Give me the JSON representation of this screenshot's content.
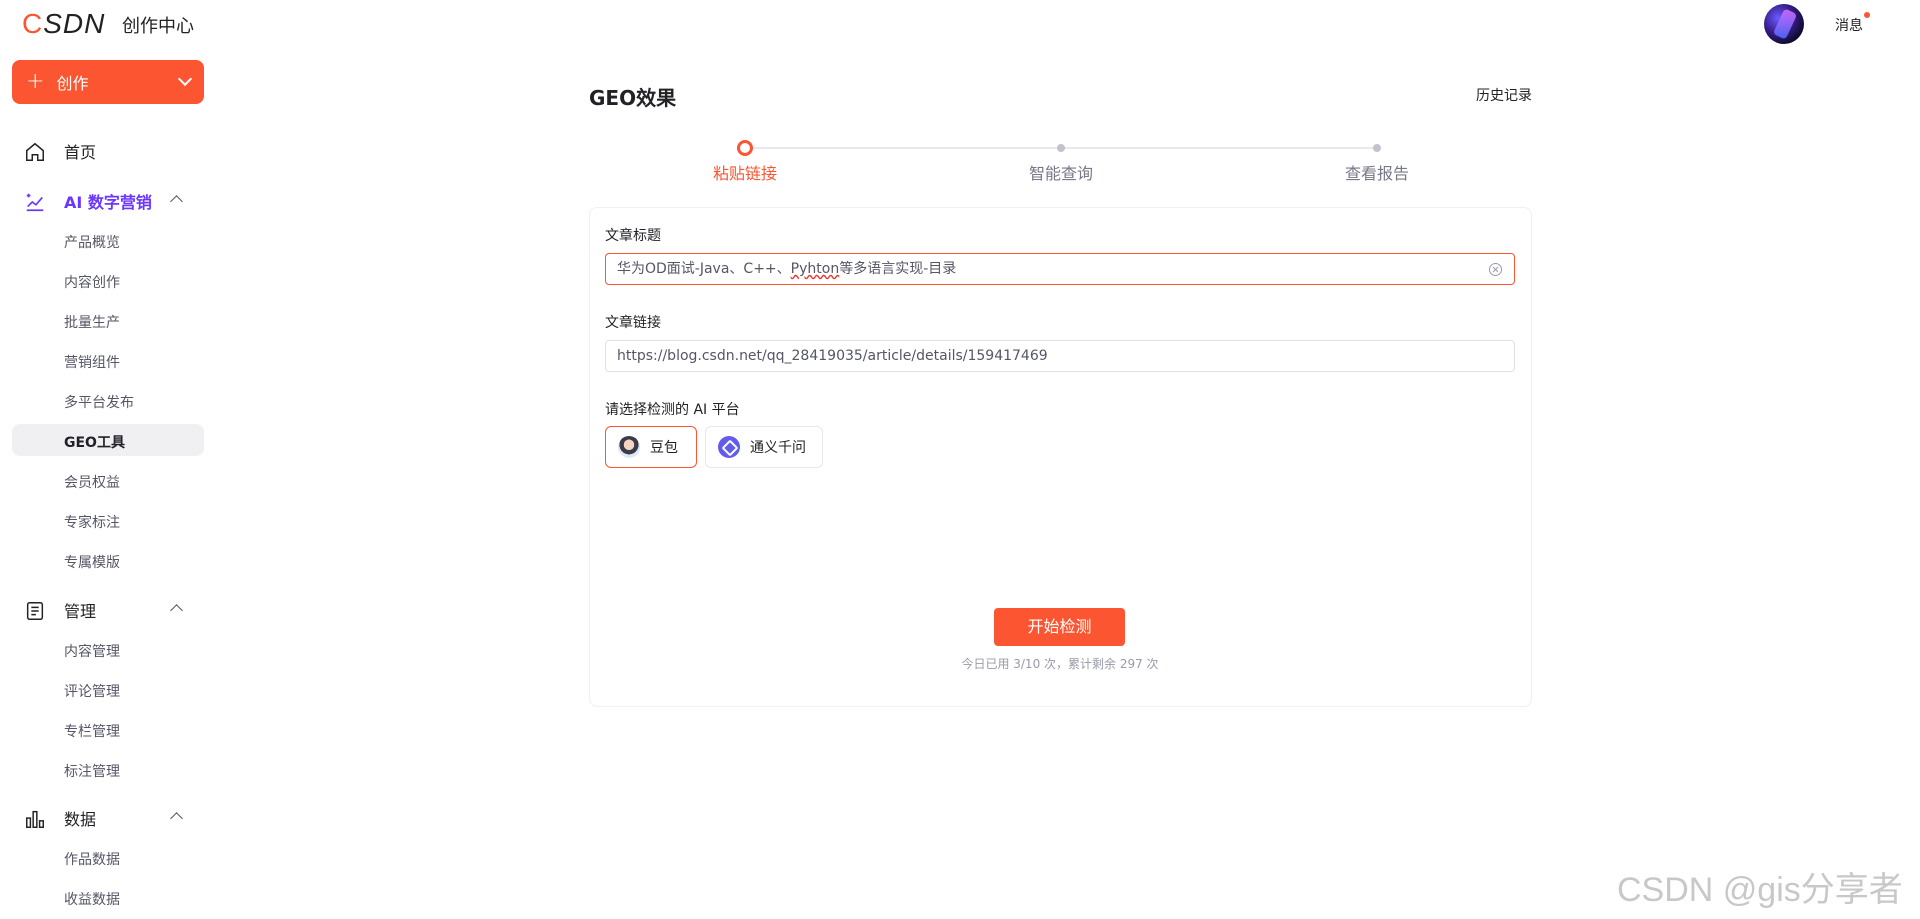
{
  "header": {
    "logo": "CSDN",
    "app_title": "创作中心",
    "messages_label": "消息"
  },
  "sidebar": {
    "create_button": "创作",
    "home": "首页",
    "sections": [
      {
        "title": "AI 数字营销",
        "items": [
          "产品概览",
          "内容创作",
          "批量生产",
          "营销组件",
          "多平台发布",
          "GEO工具",
          "会员权益",
          "专家标注",
          "专属模版"
        ]
      },
      {
        "title": "管理",
        "items": [
          "内容管理",
          "评论管理",
          "专栏管理",
          "标注管理"
        ]
      },
      {
        "title": "数据",
        "items": [
          "作品数据",
          "收益数据"
        ]
      }
    ],
    "active_item": "GEO工具"
  },
  "main": {
    "title": "GEO效果",
    "history_link": "历史记录",
    "steps": [
      "粘贴链接",
      "智能查询",
      "查看报告"
    ],
    "current_step": 1,
    "form": {
      "title_label": "文章标题",
      "title_value_a": "华为OD面试-Java、C++、",
      "title_value_misspelled": "Pyhton",
      "title_value_b": "等多语言实现-目录",
      "link_label": "文章链接",
      "link_value": "https://blog.csdn.net/qq_28419035/article/details/159417469",
      "platform_label": "请选择检测的 AI 平台",
      "platforms": [
        {
          "name": "豆包",
          "selected": true,
          "icon": "doubao-icon"
        },
        {
          "name": "通义千问",
          "selected": false,
          "icon": "tongyi-icon"
        }
      ],
      "submit_label": "开始检测",
      "quota_text": "今日已用 3/10 次，累计剩余 297 次"
    }
  },
  "watermark": "CSDN @gis分享者",
  "colors": {
    "accent": "#fc5531",
    "ai_section": "#6b37ff"
  }
}
